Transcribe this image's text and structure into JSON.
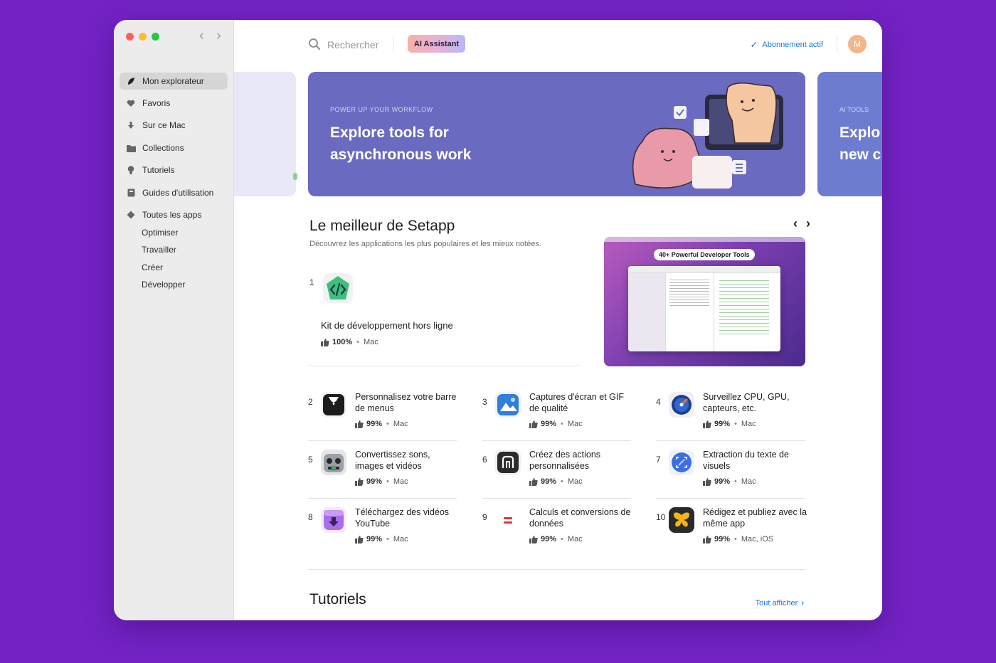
{
  "colors": {
    "desktop_background": "#7322c4",
    "accent_blue": "#1576e4",
    "banner_purple": "#6a6ac0",
    "sidebar_bg": "#ececec"
  },
  "sidebar": {
    "items": [
      {
        "label": "Mon explorateur",
        "icon": "leaf-icon",
        "active": true
      },
      {
        "label": "Favoris",
        "icon": "heart-icon"
      },
      {
        "label": "Sur ce Mac",
        "icon": "download-arrow-icon"
      },
      {
        "label": "Collections",
        "icon": "folder-icon"
      },
      {
        "label": "Tutoriels",
        "icon": "lightbulb-icon"
      },
      {
        "label": "Guides d'utilisation",
        "icon": "guide-book-icon"
      },
      {
        "label": "Toutes les apps",
        "icon": "diamond-icon"
      }
    ],
    "sub_items": [
      "Optimiser",
      "Travailler",
      "Créer",
      "Développer"
    ]
  },
  "header": {
    "search_label": "Rechercher",
    "ai_button": "AI Assistant",
    "subscription_status": "Abonnement actif",
    "avatar_initial": "M"
  },
  "banner": {
    "eyebrow": "POWER UP YOUR WORKFLOW",
    "title": "Explore tools for asynchronous work",
    "next_eyebrow": "AI TOOLS",
    "next_title_line1": "Explo",
    "next_title_line2": "new c"
  },
  "section": {
    "title": "Le meilleur de Setapp",
    "subtitle": "Découvrez les applications les plus populaires et les mieux notées."
  },
  "featured": {
    "rank": "1",
    "name": "Kit de développement hors ligne",
    "rating": "100%",
    "platform": "Mac",
    "preview_caption": "40+ Powerful Developer Tools"
  },
  "apps": [
    {
      "rank": "2",
      "name": "Personnalisez votre barre de menus",
      "rating": "99%",
      "platform": "Mac",
      "icon": "tuxedo-icon"
    },
    {
      "rank": "3",
      "name": "Captures d'écran et GIF de qualité",
      "rating": "99%",
      "platform": "Mac",
      "icon": "screenshot-icon"
    },
    {
      "rank": "4",
      "name": "Surveillez CPU, GPU, capteurs, etc.",
      "rating": "99%",
      "platform": "Mac",
      "icon": "gauge-icon"
    },
    {
      "rank": "5",
      "name": "Convertissez sons, images et vidéos",
      "rating": "99%",
      "platform": "Mac",
      "icon": "robot-icon"
    },
    {
      "rank": "6",
      "name": "Créez des actions personnalisées",
      "rating": "99%",
      "platform": "Mac",
      "icon": "command-icon"
    },
    {
      "rank": "7",
      "name": "Extraction du texte de visuels",
      "rating": "99%",
      "platform": "Mac",
      "icon": "text-scan-icon"
    },
    {
      "rank": "8",
      "name": "Téléchargez des vidéos YouTube",
      "rating": "99%",
      "platform": "Mac",
      "icon": "download-box-icon"
    },
    {
      "rank": "9",
      "name": "Calculs et conversions de données",
      "rating": "99%",
      "platform": "Mac",
      "icon": "equals-icon"
    },
    {
      "rank": "10",
      "name": "Rédigez et publiez avec la même app",
      "rating": "99%",
      "platform": "Mac, iOS",
      "icon": "butterfly-icon"
    }
  ],
  "tutorials": {
    "title": "Tutoriels",
    "see_all": "Tout afficher"
  }
}
